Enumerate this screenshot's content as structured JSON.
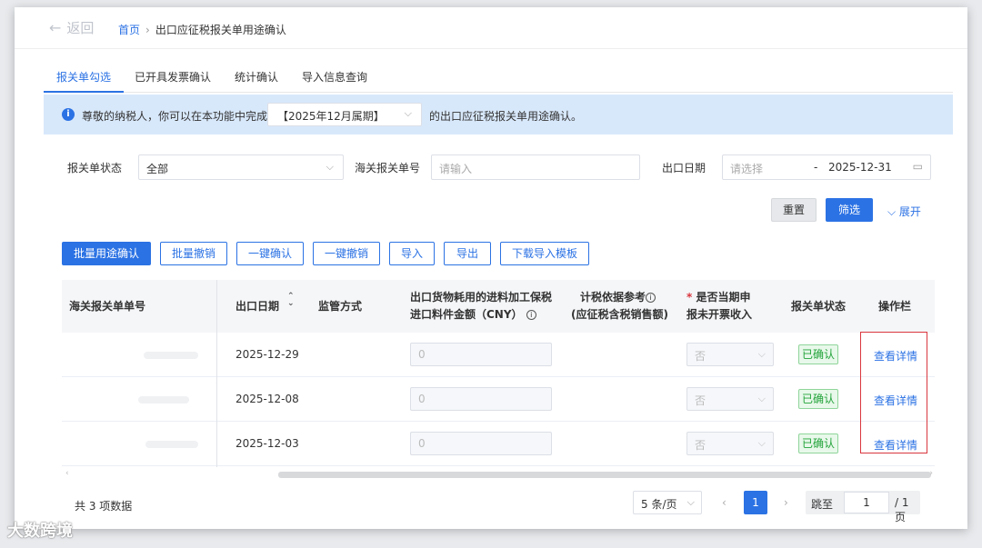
{
  "topbar": {
    "back_label": "返回",
    "breadcrumb_home": "首页",
    "breadcrumb_sep": "›",
    "breadcrumb_current": "出口应征税报关单用途确认"
  },
  "tabs": [
    {
      "label": "报关单勾选",
      "active": true
    },
    {
      "label": "已开具发票确认",
      "active": false
    },
    {
      "label": "统计确认",
      "active": false
    },
    {
      "label": "导入信息查询",
      "active": false
    }
  ],
  "notice": {
    "prefix": "尊敬的纳税人，你可以在本功能中完成",
    "period_value": "【2025年12月属期】",
    "suffix": "的出口应征税报关单用途确认。"
  },
  "filters": {
    "status_label": "报关单状态",
    "status_value": "全部",
    "customs_no_label": "海关报关单号",
    "customs_no_placeholder": "请输入",
    "export_date_label": "出口日期",
    "export_date_start_placeholder": "请选择",
    "date_sep": "-",
    "export_date_end": "2025-12-31"
  },
  "filter_buttons": {
    "reset": "重置",
    "filter": "筛选",
    "expand": "展开"
  },
  "actions": [
    "批量用途确认",
    "批量撤销",
    "一键确认",
    "一键撤销",
    "导入",
    "导出",
    "下载导入模板"
  ],
  "table": {
    "headers": {
      "customs_no": "海关报关单单号",
      "export_date": "出口日期",
      "supervision": "监管方式",
      "material_amount_line1": "出口货物耗用的进料加工保税",
      "material_amount_line2": "进口料件金额（CNY）",
      "tax_ref_line1": "计税依据参考",
      "tax_ref_line2": "(应征税含税销售额)",
      "invoice_required": "*",
      "invoice_line1": "是否当期申",
      "invoice_line2": "报未开票收入",
      "status": "报关单状态",
      "ops": "操作栏"
    },
    "rows": [
      {
        "export_date": "2025-12-29",
        "amount": "0",
        "invoice": "否",
        "status": "已确认",
        "op": "查看详情"
      },
      {
        "export_date": "2025-12-08",
        "amount": "0",
        "invoice": "否",
        "status": "已确认",
        "op": "查看详情"
      },
      {
        "export_date": "2025-12-03",
        "amount": "0",
        "invoice": "否",
        "status": "已确认",
        "op": "查看详情"
      }
    ]
  },
  "pagination": {
    "total": "共 3 项数据",
    "page_size": "5 条/页",
    "current": "1",
    "jump_label": "跳至",
    "jump_value": "1",
    "pages": "/ 1 页"
  },
  "watermark": "大数跨境",
  "colors": {
    "primary": "#2b72e4",
    "notice_bg": "#d8e8fb",
    "success": "#22a33a",
    "highlight": "#d9363e"
  }
}
